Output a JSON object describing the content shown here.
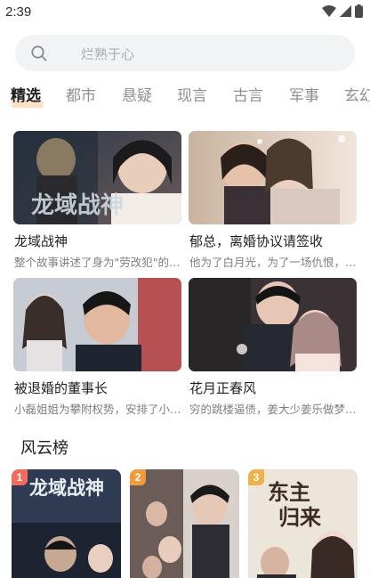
{
  "status_bar": {
    "time": "2:39",
    "wifi_icon": "wifi-icon",
    "signal_icon": "signal-icon",
    "battery_icon": "battery-icon"
  },
  "search": {
    "placeholder": "烂熟于心",
    "icon": "search-icon"
  },
  "tabs": [
    {
      "label": "精选",
      "active": true
    },
    {
      "label": "都市"
    },
    {
      "label": "悬疑"
    },
    {
      "label": "现言"
    },
    {
      "label": "古言"
    },
    {
      "label": "军事"
    },
    {
      "label": "玄幻"
    }
  ],
  "cards": [
    {
      "title": "龙域战神",
      "desc": "整个故事讲述了身为\"劳改犯\"的…",
      "poster_text": "龙域战神"
    },
    {
      "title": "郁总，离婚协议请签收",
      "desc": "他为了白月光，为了一场仇恨，…"
    },
    {
      "title": "被退婚的董事长",
      "desc": "小磊姐姐为攀附权势，安排了小…"
    },
    {
      "title": "花月正春风",
      "desc": "穷的跳楼逼债，姜大少姜乐做梦…"
    }
  ],
  "ranking": {
    "title": "风云榜",
    "items": [
      {
        "rank": "1",
        "poster_text": "龙域战神"
      },
      {
        "rank": "2"
      },
      {
        "rank": "3",
        "poster_text": "东主归来"
      }
    ]
  },
  "colors": {
    "accent": "#ffe1c6",
    "badge": "#f26b5b",
    "search_bg": "#f2f3f5"
  }
}
